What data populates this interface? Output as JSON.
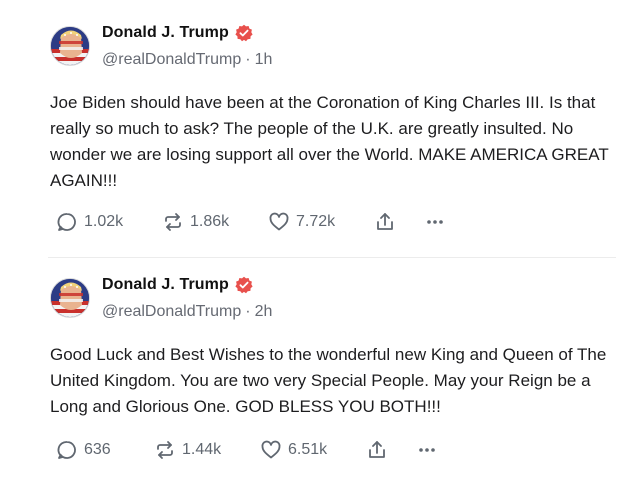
{
  "posts": [
    {
      "author": "Donald J. Trump",
      "handle": "@realDonaldTrump",
      "separator": "·",
      "time": "1h",
      "text": "Joe Biden should have been at the Coronation of King Charles III. Is that really so much to ask? The people of the U.K. are greatly insulted. No wonder we are losing support all over the World. MAKE AMERICA GREAT AGAIN!!!",
      "replies": "1.02k",
      "retruths": "1.86k",
      "likes": "7.72k"
    },
    {
      "author": "Donald J. Trump",
      "handle": "@realDonaldTrump",
      "separator": "·",
      "time": "2h",
      "text": "Good Luck and Best Wishes to the wonderful new King and Queen of The United Kingdom. You are two very Special People. May your Reign be a Long and Glorious One. GOD BLESS YOU BOTH!!!",
      "replies": "636",
      "retruths": "1.44k",
      "likes": "6.51k"
    }
  ],
  "icons": {
    "verified": "verified-badge-icon",
    "reply": "reply-bubble-icon",
    "retruth": "retruth-arrows-icon",
    "like": "heart-icon",
    "share": "share-upload-icon",
    "more": "more-dots-icon"
  },
  "colors": {
    "verified_badge": "#e8504c",
    "action_gray": "#606770",
    "handle_gray": "#666a73"
  }
}
